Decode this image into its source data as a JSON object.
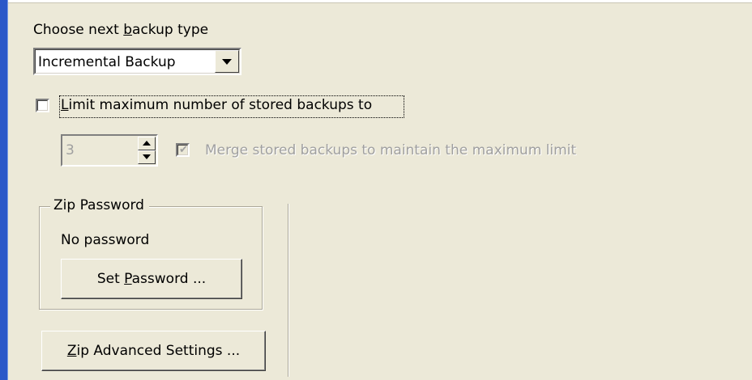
{
  "backup_type": {
    "label_prefix": "Choose next ",
    "label_mnemonic": "b",
    "label_suffix": "ackup type",
    "selected": "Incremental Backup"
  },
  "limit": {
    "label_mnemonic": "L",
    "label_rest": "imit maximum number of stored backups to",
    "checked": false
  },
  "max_count": {
    "value": "3"
  },
  "merge": {
    "label": "Merge stored backups to maintain the maximum limit",
    "checked": true,
    "enabled": false
  },
  "zip_password": {
    "group_title": "Zip Password",
    "status": "No password",
    "button_prefix": "Set ",
    "button_mnemonic": "P",
    "button_suffix": "assword ..."
  },
  "zip_advanced": {
    "button_mnemonic": "Z",
    "button_suffix": "ip Advanced Settings ..."
  },
  "colors": {
    "background": "#ece9d8",
    "accent_bar": "#2a58c8",
    "disabled_text": "#a0a0a0"
  }
}
